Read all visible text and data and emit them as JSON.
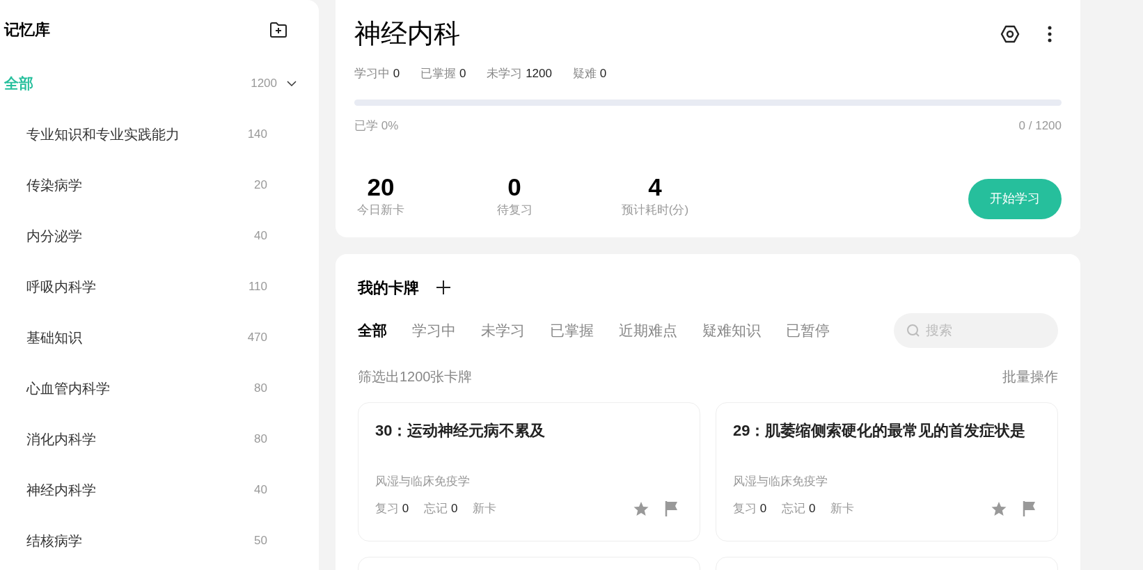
{
  "sidebar": {
    "title": "记忆库",
    "groups": [
      {
        "label": "全部",
        "count": "1200",
        "selected": true,
        "expanded": true,
        "children": [
          {
            "label": "专业知识和专业实践能力",
            "count": "140",
            "selected": false
          },
          {
            "label": "传染病学",
            "count": "20",
            "selected": false
          },
          {
            "label": "内分泌学",
            "count": "40",
            "selected": false
          },
          {
            "label": "呼吸内科学",
            "count": "110",
            "selected": false
          },
          {
            "label": "基础知识",
            "count": "470",
            "selected": false
          },
          {
            "label": "心血管内科学",
            "count": "80",
            "selected": false
          },
          {
            "label": "消化内科学",
            "count": "80",
            "selected": false
          },
          {
            "label": "神经内科学",
            "count": "40",
            "selected": false
          },
          {
            "label": "结核病学",
            "count": "50",
            "selected": false
          }
        ]
      }
    ]
  },
  "deck": {
    "title": "神经内科",
    "counts": [
      {
        "label": "学习中",
        "value": "0"
      },
      {
        "label": "已掌握",
        "value": "0"
      },
      {
        "label": "未学习",
        "value": "1200"
      },
      {
        "label": "疑难",
        "value": "0"
      }
    ],
    "progress": {
      "level": 0,
      "label": "已学 0%",
      "reading": "0 / 1200"
    },
    "stats": [
      {
        "value": "20",
        "label": "今日新卡"
      },
      {
        "value": "0",
        "label": "待复习"
      },
      {
        "value": "4",
        "label": "预计耗时(分)"
      }
    ],
    "start_button": "开始学习"
  },
  "cards_panel": {
    "title": "我的卡牌",
    "tabs": [
      {
        "label": "全部",
        "selected": true
      },
      {
        "label": "学习中",
        "selected": false
      },
      {
        "label": "未学习",
        "selected": false
      },
      {
        "label": "已掌握",
        "selected": false
      },
      {
        "label": "近期难点",
        "selected": false
      },
      {
        "label": "疑难知识",
        "selected": false
      },
      {
        "label": "已暂停",
        "selected": false
      }
    ],
    "search": {
      "placeholder": "搜索"
    },
    "filter_summary": "筛选出1200张卡牌",
    "batch_action": "批量操作",
    "cards": [
      {
        "title": "30：运动神经元病不累及",
        "category": "风湿与临床免疫学",
        "review_label": "复习",
        "review": "0",
        "forget_label": "忘记",
        "forget": "0",
        "status": "新卡"
      },
      {
        "title": "29：肌萎缩侧索硬化的最常见的首发症状是",
        "category": "风湿与临床免疫学",
        "review_label": "复习",
        "review": "0",
        "forget_label": "忘记",
        "forget": "0",
        "status": "新卡"
      }
    ]
  }
}
